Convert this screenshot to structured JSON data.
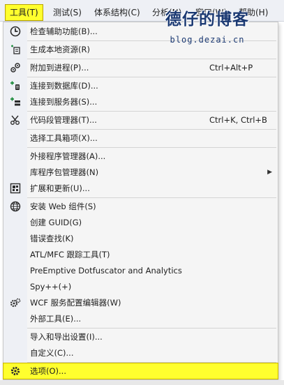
{
  "menubar": {
    "items": [
      {
        "label": "工具(T)"
      },
      {
        "label": "测试(S)"
      },
      {
        "label": "体系结构(C)"
      },
      {
        "label": "分析(N)"
      },
      {
        "label": "窗口(W)"
      },
      {
        "label": "帮助(H)"
      }
    ]
  },
  "watermark": {
    "title": "德仔的博客",
    "url": "blog.dezai.cn"
  },
  "menu": {
    "items": [
      {
        "label": "检查辅助功能(B)...",
        "shortcut": "",
        "icon": "accessibility-check-icon"
      },
      {
        "label": "生成本地资源(R)",
        "shortcut": "",
        "icon": "generate-resources-icon"
      },
      {
        "label": "附加到进程(P)...",
        "shortcut": "Ctrl+Alt+P",
        "icon": "attach-process-icon"
      },
      {
        "label": "连接到数据库(D)...",
        "shortcut": "",
        "icon": "connect-database-icon"
      },
      {
        "label": "连接到服务器(S)...",
        "shortcut": "",
        "icon": "connect-server-icon"
      },
      {
        "label": "代码段管理器(T)...",
        "shortcut": "Ctrl+K, Ctrl+B",
        "icon": "code-snippets-icon"
      },
      {
        "label": "选择工具箱项(X)...",
        "shortcut": "",
        "icon": ""
      },
      {
        "label": "外接程序管理器(A)...",
        "shortcut": "",
        "icon": ""
      },
      {
        "label": "库程序包管理器(N)",
        "shortcut": "",
        "icon": "",
        "submenu": "▶"
      },
      {
        "label": "扩展和更新(U)...",
        "shortcut": "",
        "icon": "extensions-icon"
      },
      {
        "label": "安装 Web 组件(S)",
        "shortcut": "",
        "icon": "web-globe-icon"
      },
      {
        "label": "创建 GUID(G)",
        "shortcut": "",
        "icon": ""
      },
      {
        "label": "错误查找(K)",
        "shortcut": "",
        "icon": ""
      },
      {
        "label": "ATL/MFC 跟踪工具(T)",
        "shortcut": "",
        "icon": ""
      },
      {
        "label": "PreEmptive Dotfuscator and Analytics",
        "shortcut": "",
        "icon": ""
      },
      {
        "label": "Spy++(+)",
        "shortcut": "",
        "icon": ""
      },
      {
        "label": "WCF 服务配置编辑器(W)",
        "shortcut": "",
        "icon": "wcf-config-gear-icon"
      },
      {
        "label": "外部工具(E)...",
        "shortcut": "",
        "icon": ""
      },
      {
        "label": "导入和导出设置(I)...",
        "shortcut": "",
        "icon": ""
      },
      {
        "label": "自定义(C)...",
        "shortcut": "",
        "icon": ""
      },
      {
        "label": "选项(O)...",
        "shortcut": "",
        "icon": "options-gear-icon",
        "highlighted": true
      }
    ]
  },
  "colors": {
    "highlight": "#ffff2e",
    "menu_bg": "#f5f5f5",
    "gutter_bg": "#eef0f5",
    "watermark": "#1c3a73"
  }
}
